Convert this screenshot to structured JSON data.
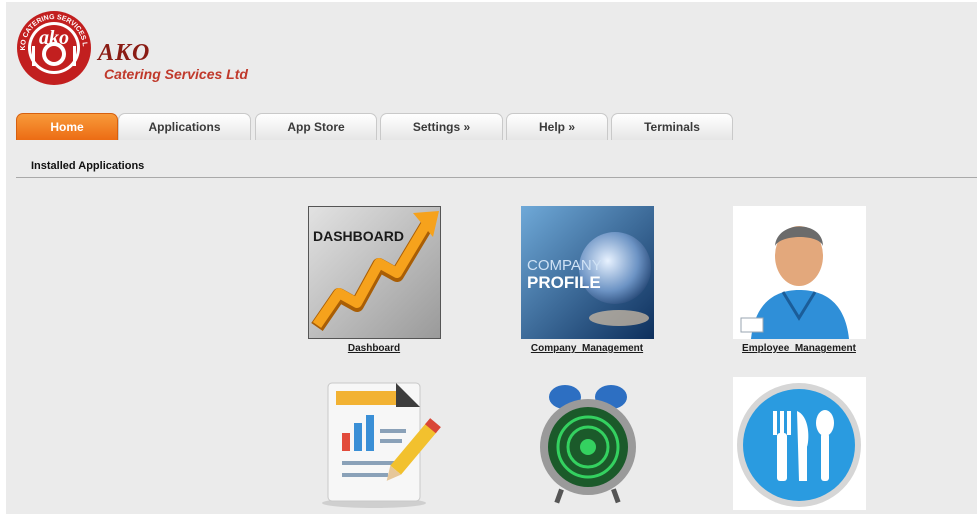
{
  "brand": {
    "seal_text": "AKO CATERING SERVICES LTD",
    "seal_initials": "ako",
    "name": "AKO",
    "tagline": "Catering Services Ltd"
  },
  "tabs": [
    {
      "label": "Home",
      "active": true
    },
    {
      "label": "Applications",
      "active": false
    },
    {
      "label": "App Store",
      "active": false
    },
    {
      "label": "Settings »",
      "active": false
    },
    {
      "label": "Help »",
      "active": false
    },
    {
      "label": "Terminals",
      "active": false
    }
  ],
  "section": {
    "title": "Installed Applications"
  },
  "apps": [
    {
      "label": "Dashboard",
      "image_text": "DASHBOARD",
      "icon": "dashboard-chart-icon"
    },
    {
      "label": "Company_Management",
      "image_text_1": "COMPANY",
      "image_text_2": "PROFILE",
      "icon": "company-profile-globe-icon"
    },
    {
      "label": "Employee_Management",
      "icon": "employee-avatar-icon"
    },
    {
      "label": "",
      "icon": "report-document-pencil-icon"
    },
    {
      "label": "",
      "icon": "alarm-clock-icon"
    },
    {
      "label": "",
      "icon": "cutlery-plate-icon"
    }
  ],
  "colors": {
    "accent": "#ec6c14",
    "brand": "#8a1c14",
    "page_bg": "#ebebeb"
  }
}
